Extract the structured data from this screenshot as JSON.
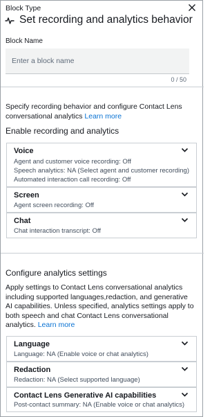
{
  "header": {
    "block_type_label": "Block Type",
    "title": "Set recording and analytics behavior"
  },
  "block_name": {
    "label": "Block Name",
    "placeholder": "Enter a block name",
    "value": "",
    "counter": "0 / 50"
  },
  "recording": {
    "intro_text": "Specify recording behavior and configure Contact Lens conversational analytics ",
    "learn_more": "Learn more",
    "heading": "Enable recording and analytics",
    "cards": [
      {
        "title": "Voice",
        "lines": [
          "Agent and customer voice recording: Off",
          "Speech analytics: NA (Select agent and customer recording)",
          "Automated interaction call recording: Off"
        ]
      },
      {
        "title": "Screen",
        "lines": [
          "Agent screen recording: Off"
        ]
      },
      {
        "title": "Chat",
        "lines": [
          "Chat interaction transcript: Off"
        ]
      }
    ]
  },
  "analytics": {
    "heading": "Configure analytics settings",
    "intro_text": "Apply settings to Contact Lens conversational analytics including supported languages,redaction, and generative AI capabilities. Unless specified, analytics settings apply to both speech and chat Contact Lens conversational analytics. ",
    "learn_more": "Learn more",
    "cards": [
      {
        "title": "Language",
        "lines": [
          "Language: NA (Enable voice or chat analytics)"
        ]
      },
      {
        "title": "Redaction",
        "lines": [
          "Redaction: NA (Select supported language)"
        ]
      },
      {
        "title": "Contact Lens Generative AI capabilities",
        "lines": [
          "Post-contact summary: NA (Enable voice or chat analytics)"
        ]
      }
    ]
  },
  "icons": {
    "close": "close-icon",
    "header": "flow-block-icon",
    "expand": "chevron-down-icon"
  }
}
